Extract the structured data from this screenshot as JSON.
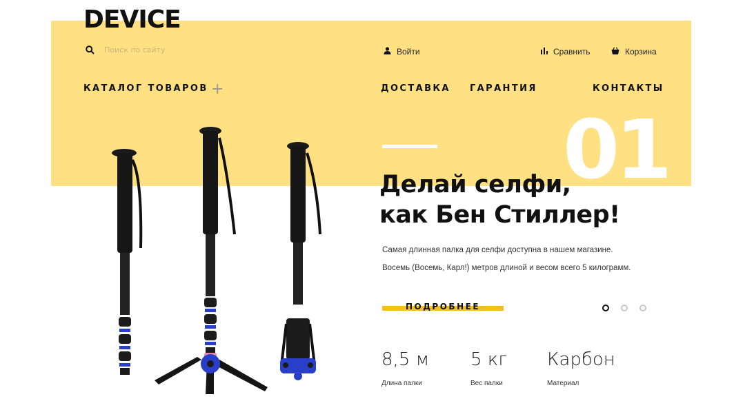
{
  "header": {
    "logo": "DEVICE",
    "search_placeholder": "Поиск по сайту",
    "login_label": "Войти",
    "compare_label": "Сравнить",
    "cart_label": "Корзина"
  },
  "nav": {
    "catalog": "КАТАЛОГ ТОВАРОВ",
    "catalog_icon": "plus-icon",
    "delivery": "ДОСТАВКА",
    "guarantee": "ГАРАНТИЯ",
    "contacts": "КОНТАКТЫ"
  },
  "slide": {
    "number": "01",
    "title_line1": "Делай селфи,",
    "title_line2": "как Бен Стиллер!",
    "description_line1": "Самая длинная палка для селфи доступна в нашем магазине.",
    "description_line2": "Восемь (Восемь, Карл!) метров длиной и весом всего 5 килограмм.",
    "button_label": "ПОДРОБНЕЕ",
    "dots_total": 3,
    "active_dot": 1
  },
  "stats": [
    {
      "value": "8,5 м",
      "label": "Длина палки"
    },
    {
      "value": "5 кг",
      "label": "Вес палки"
    },
    {
      "value": "Карбон",
      "label": "Материал"
    }
  ],
  "colors": {
    "band": "#ffe082",
    "accent": "#f4c11a",
    "text": "#111111"
  }
}
